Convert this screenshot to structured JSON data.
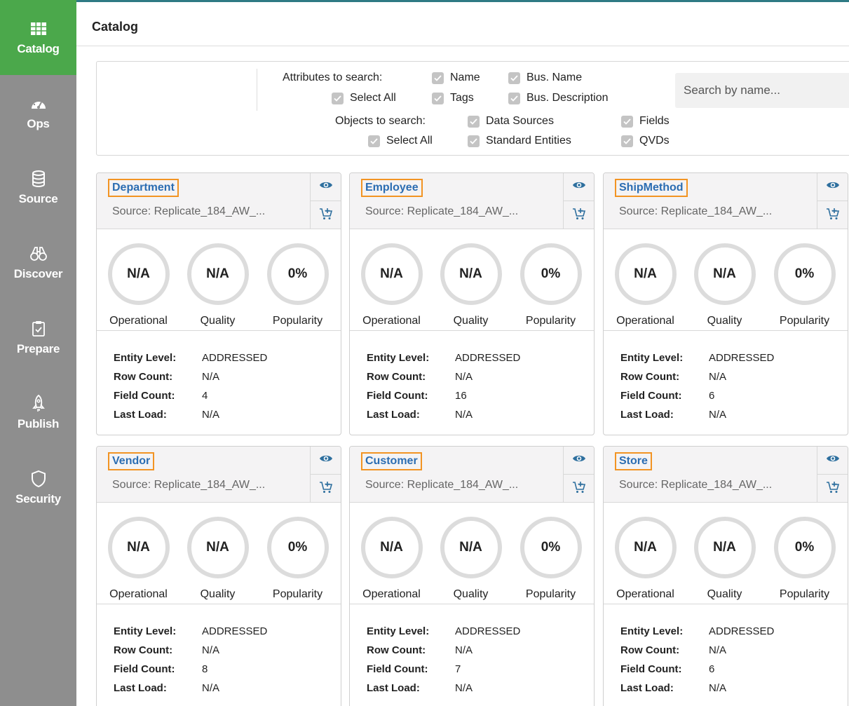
{
  "app": {
    "title": "Catalog"
  },
  "sidebar": {
    "items": [
      {
        "label": "Catalog",
        "icon": "grid-icon",
        "active": true
      },
      {
        "label": "Ops",
        "icon": "gauge-icon"
      },
      {
        "label": "Source",
        "icon": "database-icon"
      },
      {
        "label": "Discover",
        "icon": "binoculars-icon"
      },
      {
        "label": "Prepare",
        "icon": "clipboard-check-icon"
      },
      {
        "label": "Publish",
        "icon": "rocket-icon"
      },
      {
        "label": "Security",
        "icon": "shield-icon"
      }
    ]
  },
  "search": {
    "attributes_label": "Attributes to search:",
    "attributes": [
      {
        "label": "Name",
        "checked": true
      },
      {
        "label": "Bus. Name",
        "checked": true
      },
      {
        "label": "Select All",
        "checked": true
      },
      {
        "label": "Tags",
        "checked": true
      },
      {
        "label": "Bus. Description",
        "checked": true
      }
    ],
    "objects_label": "Objects to search:",
    "objects": [
      {
        "label": "Data Sources",
        "checked": true
      },
      {
        "label": "Fields",
        "checked": true
      },
      {
        "label": "Select All",
        "checked": true
      },
      {
        "label": "Standard Entities",
        "checked": true
      },
      {
        "label": "QVDs",
        "checked": true
      }
    ],
    "placeholder": "Search by name..."
  },
  "metric_labels": {
    "operational": "Operational",
    "quality": "Quality",
    "popularity": "Popularity"
  },
  "detail_labels": {
    "entity_level": "Entity Level:",
    "row_count": "Row Count:",
    "field_count": "Field Count:",
    "last_load": "Last Load:"
  },
  "cards": [
    {
      "name": "Department",
      "source": "Source: Replicate_184_AW_...",
      "operational": "N/A",
      "quality": "N/A",
      "popularity": "0%",
      "entity_level": "ADDRESSED",
      "row_count": "N/A",
      "field_count": "4",
      "last_load": "N/A"
    },
    {
      "name": "Employee",
      "source": "Source: Replicate_184_AW_...",
      "operational": "N/A",
      "quality": "N/A",
      "popularity": "0%",
      "entity_level": "ADDRESSED",
      "row_count": "N/A",
      "field_count": "16",
      "last_load": "N/A"
    },
    {
      "name": "ShipMethod",
      "source": "Source: Replicate_184_AW_...",
      "operational": "N/A",
      "quality": "N/A",
      "popularity": "0%",
      "entity_level": "ADDRESSED",
      "row_count": "N/A",
      "field_count": "6",
      "last_load": "N/A"
    },
    {
      "name": "Vendor",
      "source": "Source: Replicate_184_AW_...",
      "operational": "N/A",
      "quality": "N/A",
      "popularity": "0%",
      "entity_level": "ADDRESSED",
      "row_count": "N/A",
      "field_count": "8",
      "last_load": "N/A"
    },
    {
      "name": "Customer",
      "source": "Source: Replicate_184_AW_...",
      "operational": "N/A",
      "quality": "N/A",
      "popularity": "0%",
      "entity_level": "ADDRESSED",
      "row_count": "N/A",
      "field_count": "7",
      "last_load": "N/A"
    },
    {
      "name": "Store",
      "source": "Source: Replicate_184_AW_...",
      "operational": "N/A",
      "quality": "N/A",
      "popularity": "0%",
      "entity_level": "ADDRESSED",
      "row_count": "N/A",
      "field_count": "6",
      "last_load": "N/A"
    }
  ],
  "colors": {
    "sidebar": "#8e8e8e",
    "active": "#4ba84b",
    "highlight": "#f29423",
    "link": "#2b6db2",
    "header_accent": "#2f7a84"
  }
}
